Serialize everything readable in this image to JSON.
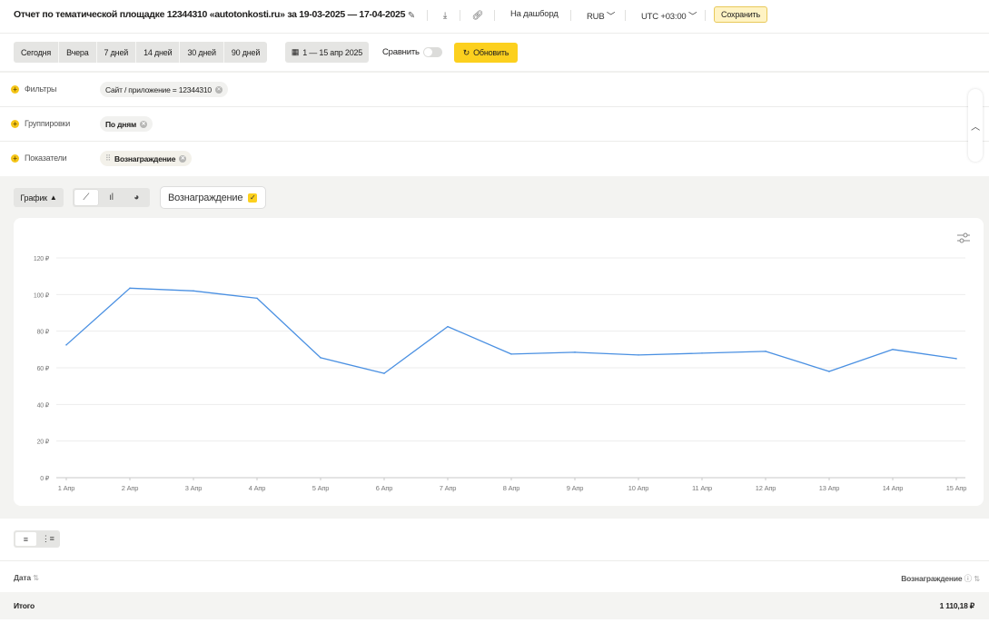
{
  "header": {
    "title": "Отчет по тематической площадке 12344310 «autotonkosti.ru» за 19-03-2025 — 17-04-2025",
    "dashboard_label": "На дашборд",
    "currency": "RUB",
    "timezone": "UTC +03:00",
    "save_label": "Сохранить"
  },
  "period": {
    "buttons": [
      "Сегодня",
      "Вчера",
      "7 дней",
      "14 дней",
      "30 дней",
      "90 дней"
    ],
    "date_range": "1 — 15 апр 2025",
    "compare_label": "Сравнить",
    "refresh_label": "Обновить"
  },
  "filters": {
    "rows": [
      {
        "label": "Фильтры",
        "chip": "Сайт / приложение = 12344310"
      },
      {
        "label": "Группировки",
        "chip": "По дням"
      },
      {
        "label": "Показатели",
        "chip": "Вознаграждение"
      }
    ]
  },
  "chart_controls": {
    "graph_label": "График",
    "metric_label": "Вознаграждение"
  },
  "colors": {
    "accent": "#fcd01e",
    "line": "#4a90e2"
  },
  "chart_data": {
    "type": "line",
    "x": [
      "1 Апр",
      "2 Апр",
      "3 Апр",
      "4 Апр",
      "5 Апр",
      "6 Апр",
      "7 Апр",
      "8 Апр",
      "9 Апр",
      "10 Апр",
      "11 Апр",
      "12 Апр",
      "13 Апр",
      "14 Апр",
      "15 Апр"
    ],
    "series": [
      {
        "name": "Вознаграждение",
        "values": [
          72.5,
          103.5,
          102,
          98,
          65.5,
          57,
          82.5,
          67.5,
          68.5,
          67,
          68,
          69,
          58,
          70,
          65
        ]
      }
    ],
    "yticks": [
      "0 ₽",
      "20 ₽",
      "40 ₽",
      "60 ₽",
      "80 ₽",
      "100 ₽",
      "120 ₽"
    ],
    "ylim": [
      0,
      120
    ],
    "grid": true
  },
  "table": {
    "col_date": "Дата",
    "col_reward": "Вознаграждение",
    "total_label": "Итого",
    "total_value": "1 110,18 ₽"
  }
}
